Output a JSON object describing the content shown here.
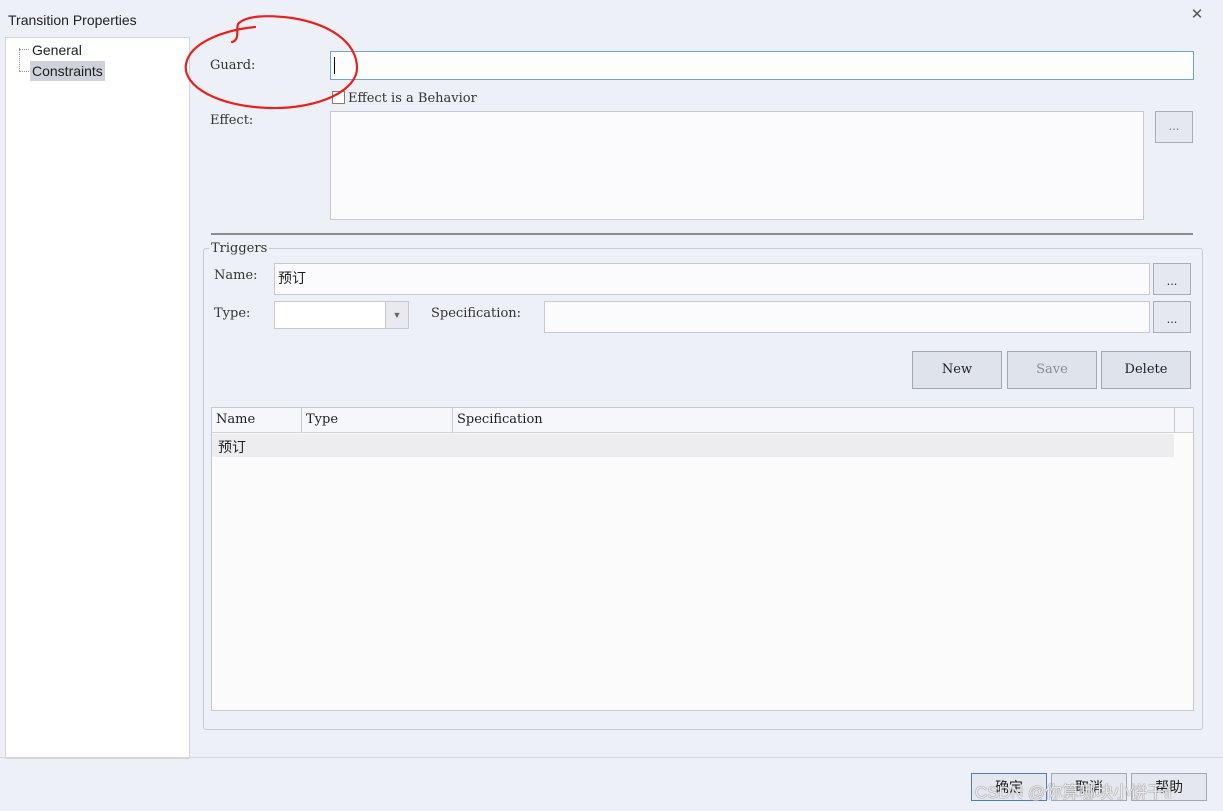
{
  "window": {
    "title": "Transition Properties"
  },
  "tree": {
    "items": [
      {
        "label": "General"
      },
      {
        "label": "Constraints"
      }
    ]
  },
  "guard": {
    "label": "Guard:",
    "value": ""
  },
  "effect": {
    "checkbox_label": "Effect is a Behavior",
    "checked": false,
    "label": "Effect:",
    "button_label": "..."
  },
  "triggers": {
    "legend": "Triggers",
    "name_label": "Name:",
    "name_value": "预订",
    "name_button": "...",
    "type_label": "Type:",
    "type_value": "",
    "spec_label": "Specification:",
    "spec_value": "",
    "spec_button": "...",
    "new_label": "New",
    "save_label": "Save",
    "delete_label": "Delete",
    "table": {
      "columns": [
        "Name",
        "Type",
        "Specification"
      ],
      "rows": [
        {
          "name": "预订",
          "type": "",
          "specification": ""
        }
      ]
    }
  },
  "footer": {
    "ok_label": "确定",
    "cancel_label": "取消",
    "help_label": "帮助"
  },
  "watermark": "CSDN @你算哪块小饼干ii",
  "annotation_color": "#e8201e",
  "icons": {
    "close": "close-icon",
    "dropdown": "chevron-down-icon"
  }
}
